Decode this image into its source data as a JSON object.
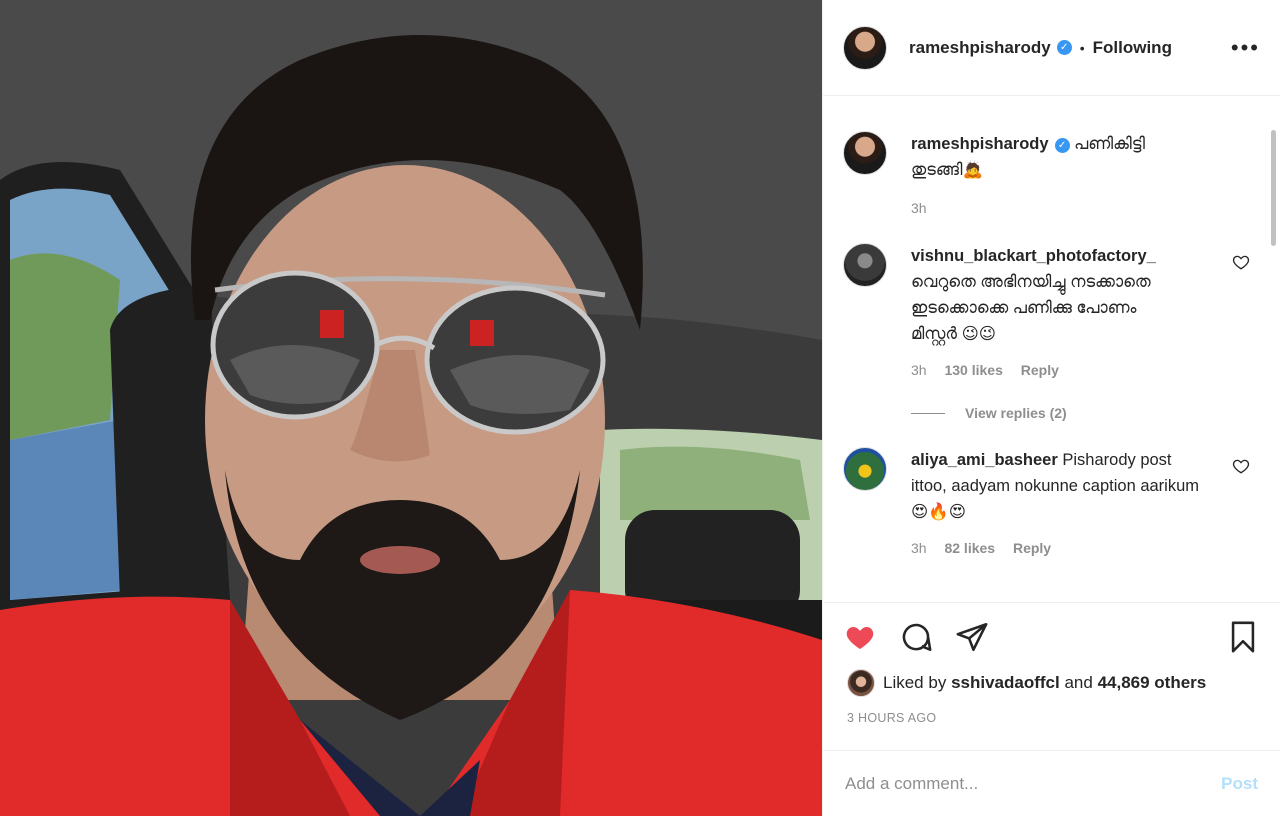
{
  "header": {
    "username": "rameshpisharody",
    "separator": "•",
    "follow_status": "Following",
    "more": "•••"
  },
  "photo": {
    "subject": "selfie in car, red shirt, aviator sunglasses",
    "colors": {
      "shirt": "#e32626",
      "car_interior": "#2a2a2a",
      "skin": "#c99a82"
    }
  },
  "caption": {
    "username": "rameshpisharody",
    "text": "പണികിട്ടി തുടങ്ങി🙇",
    "time": "3h"
  },
  "comments": [
    {
      "username": "vishnu_blackart_photofactory_",
      "text": "വെറുതെ അഭിനയിച്ചു നടക്കാതെ ഇടക്കൊക്കെ പണിക്കു പോണം മിസ്റ്റർ 😉😉",
      "time": "3h",
      "likes": "130 likes",
      "reply": "Reply",
      "view_replies": "View replies (2)"
    },
    {
      "username": "aliya_ami_basheer",
      "text": "Pisharody post ittoo, aadyam nokunne caption aarikum😍🔥😍",
      "time": "3h",
      "likes": "82 likes",
      "reply": "Reply"
    }
  ],
  "actions": {
    "liked_by_prefix": "Liked by",
    "liked_by_user": "sshivadaoffcl",
    "liked_by_suffix": "and",
    "liked_by_count": "44,869 others",
    "time_ago": "3 HOURS AGO",
    "like_color": "#ed4956"
  },
  "add_comment": {
    "placeholder": "Add a comment...",
    "post_label": "Post"
  },
  "icons": [
    "heart-icon",
    "comment-icon",
    "share-icon",
    "bookmark-icon",
    "verified-icon",
    "more-icon"
  ]
}
